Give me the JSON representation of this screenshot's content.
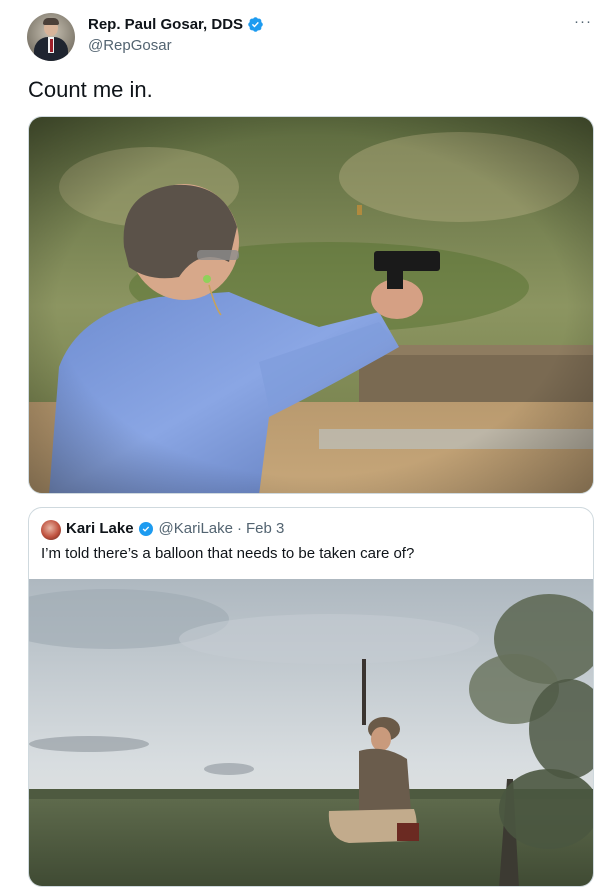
{
  "author": {
    "display_name": "Rep. Paul Gosar, DDS",
    "handle": "@RepGosar",
    "verified": true
  },
  "more_label": "···",
  "tweet": {
    "text": "Count me in."
  },
  "quoted_tweet": {
    "display_name": "Kari Lake",
    "handle": "@KariLake",
    "separator": "·",
    "date": "Feb 3",
    "text": "I’m told there’s a balloon that needs to be taken care of?",
    "verified": true
  },
  "colors": {
    "verified_blue": "#1d9bf0",
    "secondary_text": "#536471",
    "border": "#cfd9de"
  },
  "icons": {
    "verified": "verified-badge-icon",
    "more": "more-options-icon"
  }
}
